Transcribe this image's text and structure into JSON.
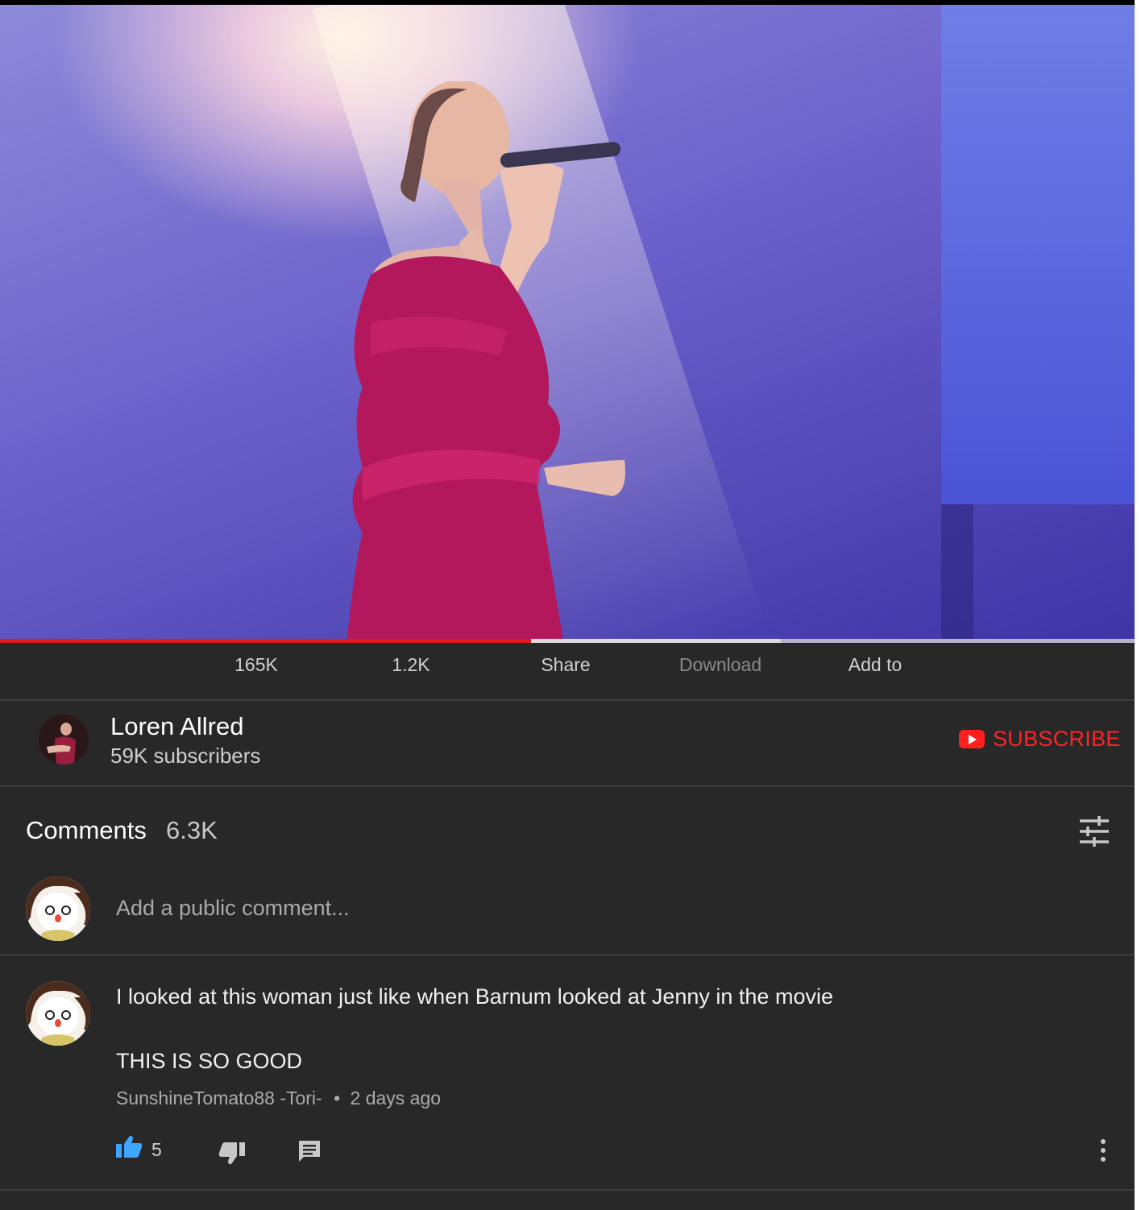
{
  "player": {
    "progress_fraction": 0.468,
    "buffered_fraction": 0.688,
    "progress_color": "#e31a1a"
  },
  "actions": [
    {
      "label": "165K",
      "disabled": false
    },
    {
      "label": "1.2K",
      "disabled": false
    },
    {
      "label": "Share",
      "disabled": false
    },
    {
      "label": "Download",
      "disabled": true
    },
    {
      "label": "Add to",
      "disabled": false
    }
  ],
  "channel": {
    "name": "Loren Allred",
    "subscribers": "59K subscribers",
    "subscribe_label": "SUBSCRIBE",
    "subscribe_color": "#ff2424"
  },
  "comments": {
    "title": "Comments",
    "count": "6.3K",
    "sort_icon": "sort-filter-icon",
    "add_placeholder": "Add a public comment...",
    "items": [
      {
        "line1": "I looked at this woman just like when Barnum looked at Jenny in the movie",
        "line2": "THIS IS SO GOOD",
        "author": "SunshineTomato88 -Tori-",
        "separator": "•",
        "time": "2 days ago",
        "likes": "5",
        "like_color": "#3ea6ff"
      }
    ]
  }
}
